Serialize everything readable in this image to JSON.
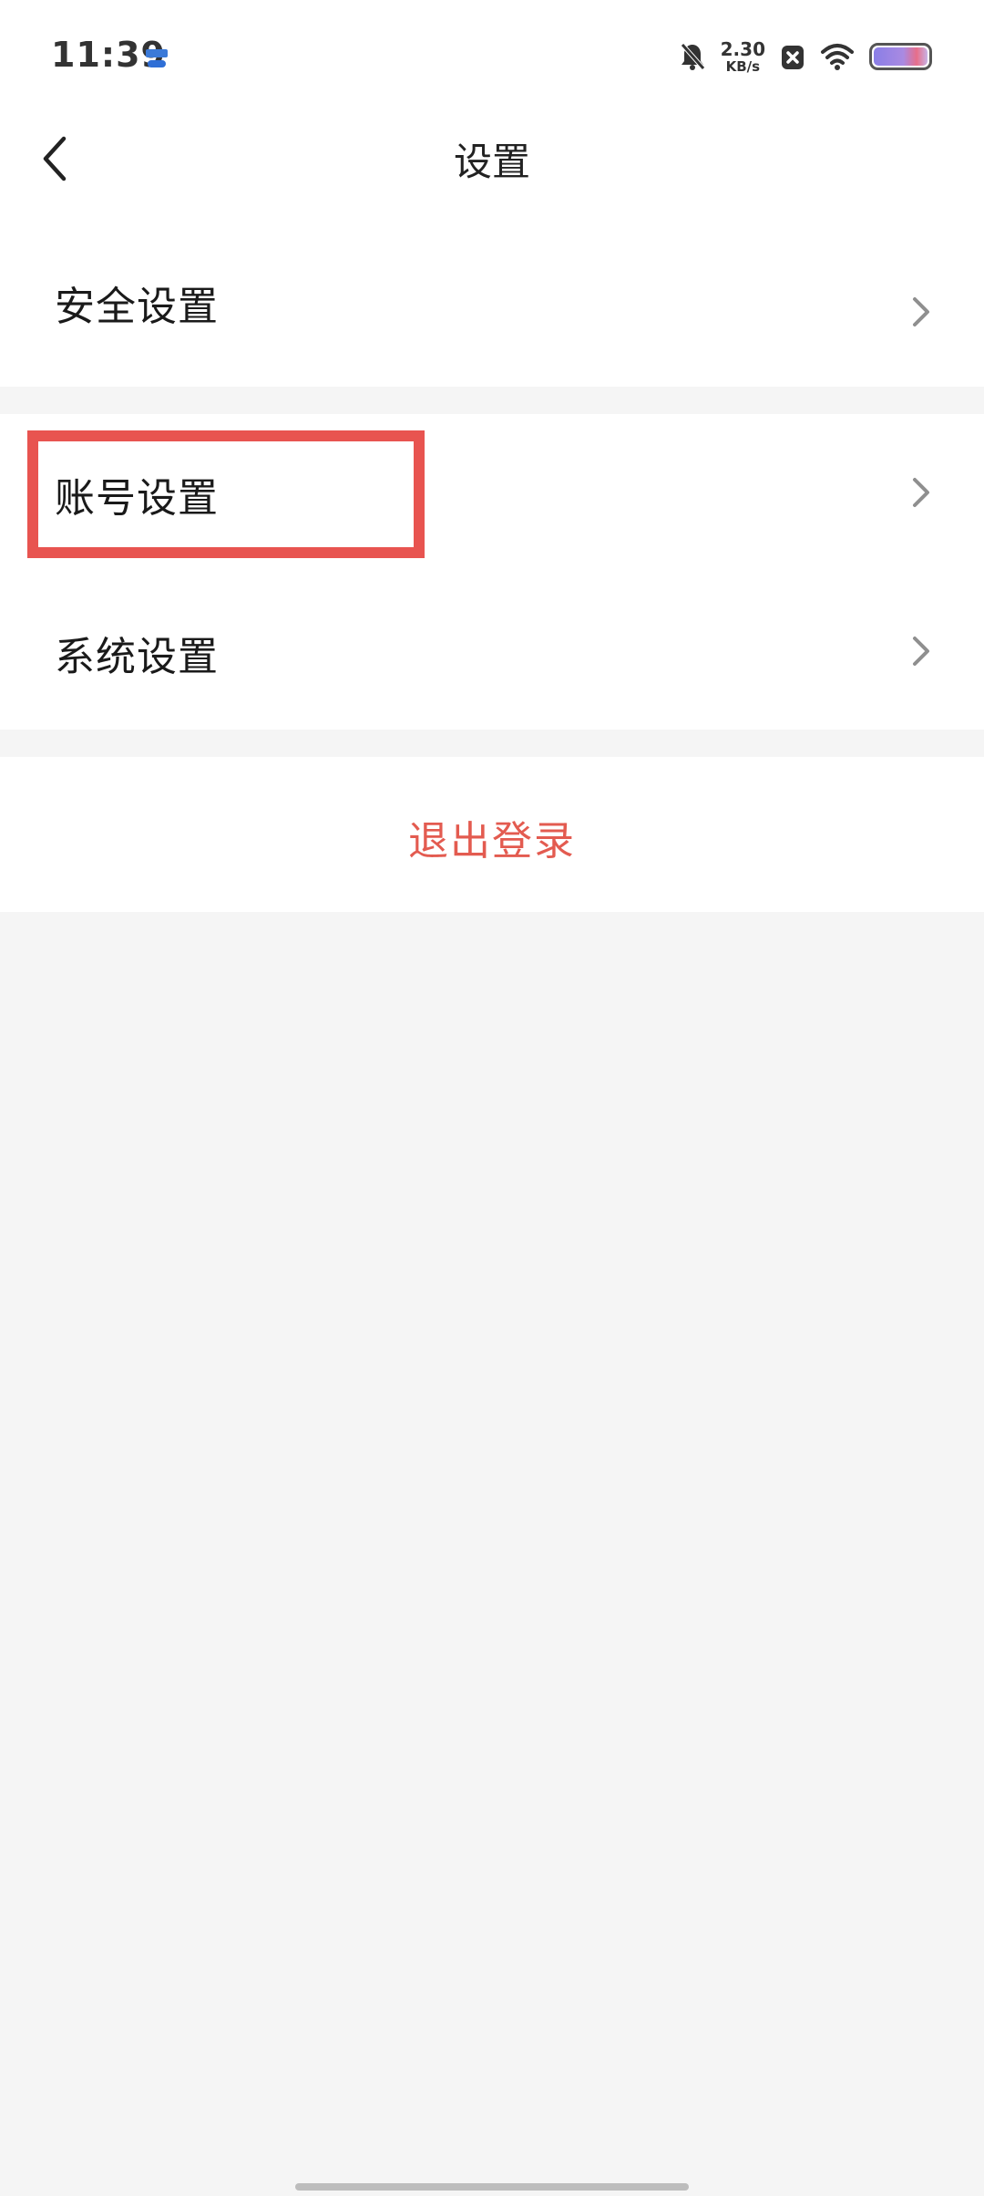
{
  "status_bar": {
    "time": "11:39",
    "speed_value": "2.30",
    "speed_unit": "KB/s",
    "icons": [
      "app-notification-icon",
      "mute-bell-icon",
      "close-square-icon",
      "wifi-icon",
      "battery-icon"
    ]
  },
  "header": {
    "title": "设置",
    "back_icon": "chevron-left-icon"
  },
  "menu": {
    "items": [
      {
        "label": "安全设置",
        "icon": "chevron-right-icon"
      },
      {
        "label": "账号设置",
        "icon": "chevron-right-icon"
      },
      {
        "label": "系统设置",
        "icon": "chevron-right-icon"
      }
    ]
  },
  "logout": {
    "label": "退出登录"
  },
  "colors": {
    "accent_red": "#e35b50",
    "highlight_border": "#e85450",
    "background": "#f5f5f5",
    "card": "#ffffff"
  }
}
